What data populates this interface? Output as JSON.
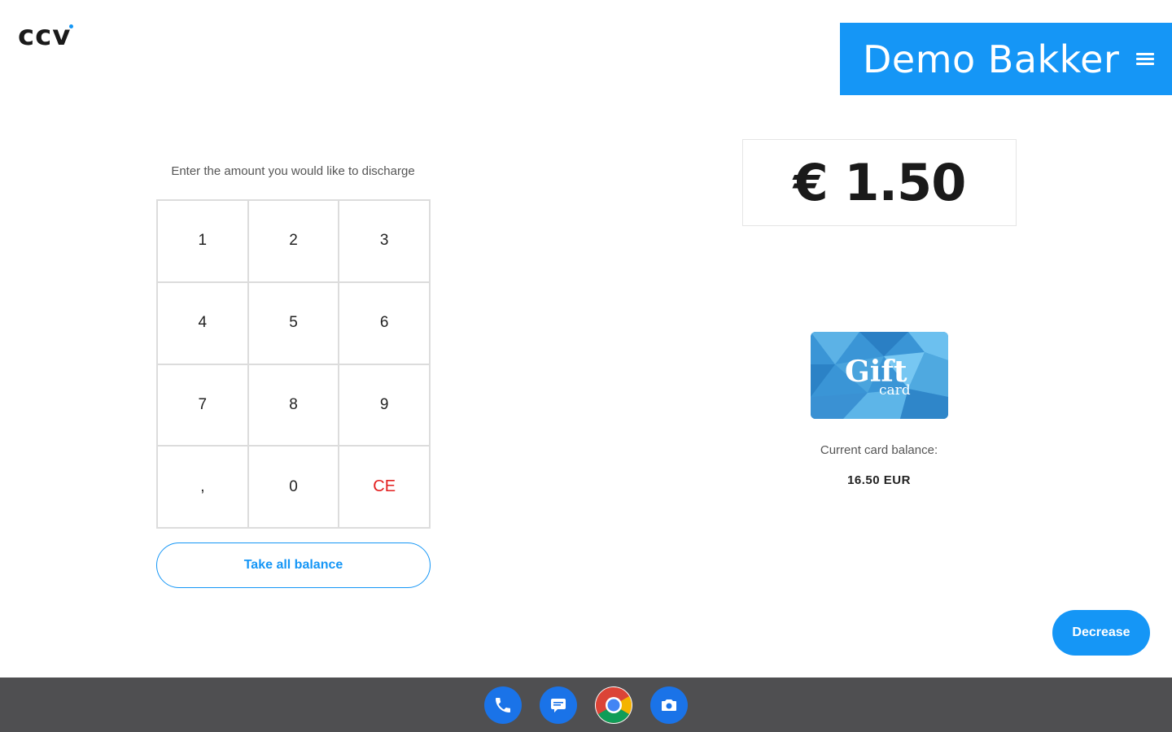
{
  "logo": {
    "text": "CCV"
  },
  "header": {
    "merchant_name": "Demo Bakker",
    "menu_icon": "hamburger-menu-icon"
  },
  "keypad": {
    "prompt": "Enter the amount you would like to discharge",
    "keys": [
      "1",
      "2",
      "3",
      "4",
      "5",
      "6",
      "7",
      "8",
      "9",
      ",",
      "0",
      "CE"
    ]
  },
  "take_all_label": "Take all balance",
  "amount": {
    "display": "€ 1.50"
  },
  "giftcard": {
    "title": "Gift",
    "subtitle": "card"
  },
  "balance": {
    "label": "Current card balance:",
    "value": "16.50 EUR"
  },
  "decrease_label": "Decrease",
  "taskbar": {
    "icons": [
      "phone-icon",
      "messages-icon",
      "chrome-icon",
      "camera-icon"
    ]
  },
  "colors": {
    "accent": "#1596f6",
    "ce": "#e32020",
    "taskbar": "#4f4f51"
  }
}
